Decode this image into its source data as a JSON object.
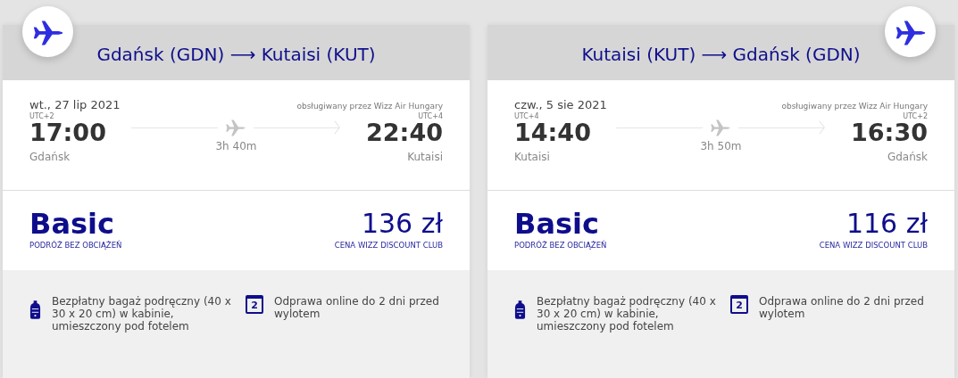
{
  "flights": [
    {
      "kind": "outbound",
      "route": "Gdańsk (GDN) ⟶ Kutaisi (KUT)",
      "date": "wt., 27 lip 2021",
      "operator": "obsługiwany przez Wizz Air Hungary",
      "departure": {
        "utc": "UTC+2",
        "time": "17:00",
        "city": "Gdańsk"
      },
      "arrival": {
        "utc": "UTC+4",
        "time": "22:40",
        "city": "Kutaisi"
      },
      "duration": "3h 40m",
      "fare": {
        "name": "Basic",
        "subtitle": "PODRÓŻ BEZ OBCIĄŻEŃ",
        "price": "136 zł",
        "price_note": "CENA WIZZ DISCOUNT CLUB"
      },
      "features": [
        {
          "kind": "bag",
          "text": "Bezpłatny bagaż podręczny (40 x 30 x 20 cm) w kabinie, umieszczony pod fotelem"
        },
        {
          "kind": "calendar",
          "day": "2",
          "text": "Odprawa online do 2 dni przed wylotem"
        }
      ]
    },
    {
      "kind": "return",
      "route": "Kutaisi (KUT) ⟶ Gdańsk (GDN)",
      "date": "czw., 5 sie 2021",
      "operator": "obsługiwany przez Wizz Air Hungary",
      "departure": {
        "utc": "UTC+4",
        "time": "14:40",
        "city": "Kutaisi"
      },
      "arrival": {
        "utc": "UTC+2",
        "time": "16:30",
        "city": "Gdańsk"
      },
      "duration": "3h 50m",
      "fare": {
        "name": "Basic",
        "subtitle": "PODRÓŻ BEZ OBCIĄŻEŃ",
        "price": "116 zł",
        "price_note": "CENA WIZZ DISCOUNT CLUB"
      },
      "features": [
        {
          "kind": "bag",
          "text": "Bezpłatny bagaż podręczny (40 x 30 x 20 cm) w kabinie, umieszczony pod fotelem"
        },
        {
          "kind": "calendar",
          "day": "2",
          "text": "Odprawa online do 2 dni przed wylotem"
        }
      ]
    }
  ]
}
